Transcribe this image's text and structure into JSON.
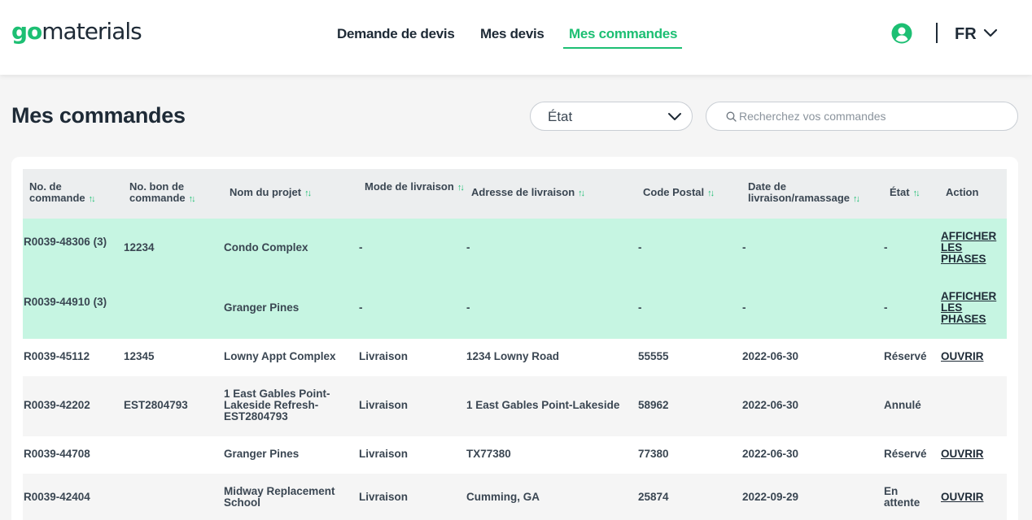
{
  "logo": {
    "go": "go",
    "rest": "materials"
  },
  "nav": {
    "items": [
      {
        "label": "Demande de devis"
      },
      {
        "label": "Mes devis"
      },
      {
        "label": "Mes commandes"
      }
    ],
    "active_index": 2
  },
  "language": {
    "code": "FR"
  },
  "page": {
    "title": "Mes commandes"
  },
  "filters": {
    "state_label": "État",
    "search_placeholder": "Recherchez vos commandes"
  },
  "table": {
    "headers": {
      "order_no": "No. de commande",
      "po_no": "No. bon de commande",
      "project": "Nom du projet",
      "delivery_mode": "Mode de livraison",
      "address": "Adresse de livraison",
      "postal": "Code Postal",
      "date": "Date de livraison/ramassage",
      "state": "État",
      "action": "Action"
    },
    "rows": [
      {
        "order_no": "R0039-48306 (3)",
        "po_no": "12234",
        "project": "Condo Complex",
        "delivery_mode": "-",
        "address": "-",
        "postal": "-",
        "date": "-",
        "state": "-",
        "action": "AFFICHER LES PHASES"
      },
      {
        "order_no": "R0039-44910 (3)",
        "po_no": "",
        "project": "Granger Pines",
        "delivery_mode": "-",
        "address": "-",
        "postal": "-",
        "date": "-",
        "state": "-",
        "action": "AFFICHER LES PHASES"
      },
      {
        "order_no": "R0039-45112",
        "po_no": "12345",
        "project": "Lowny Appt Complex",
        "delivery_mode": "Livraison",
        "address": "1234 Lowny Road",
        "postal": "55555",
        "date": "2022-06-30",
        "state": "Réservé",
        "action": "OUVRIR"
      },
      {
        "order_no": "R0039-42202",
        "po_no": "EST2804793",
        "project": "1 East Gables Point-Lakeside Refresh-EST2804793",
        "delivery_mode": "Livraison",
        "address": "1 East Gables Point-Lakeside",
        "postal": "58962",
        "date": "2022-06-30",
        "state": "Annulé",
        "action": ""
      },
      {
        "order_no": "R0039-44708",
        "po_no": "",
        "project": "Granger Pines",
        "delivery_mode": "Livraison",
        "address": "TX77380",
        "postal": "77380",
        "date": "2022-06-30",
        "state": "Réservé",
        "action": "OUVRIR"
      },
      {
        "order_no": "R0039-42404",
        "po_no": "",
        "project": "Midway Replacement School",
        "delivery_mode": "Livraison",
        "address": "Cumming, GA",
        "postal": "25874",
        "date": "2022-09-29",
        "state": "En attente",
        "action": "OUVRIR"
      }
    ]
  },
  "colors": {
    "accent": "#1dbf73",
    "expanded_row": "#c6f5e2",
    "text": "#1e2a36"
  },
  "icons": {
    "user": "user-circle-icon",
    "chevron": "chevron-down-icon",
    "search": "search-icon",
    "sort": "sort-icon"
  }
}
